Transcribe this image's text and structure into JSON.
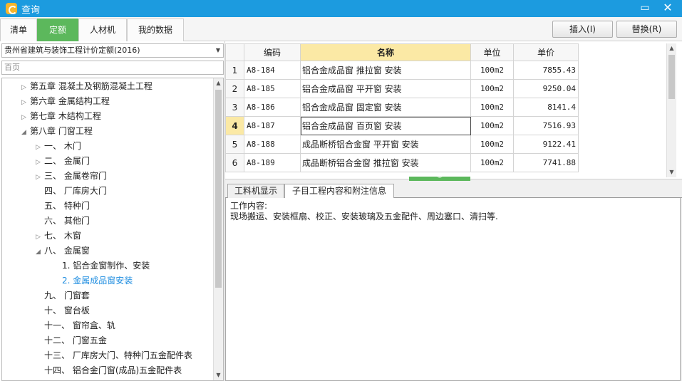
{
  "window": {
    "title": "查询",
    "minimize": "▭",
    "close": "✕"
  },
  "tabs": [
    {
      "label": "清单",
      "active": false
    },
    {
      "label": "定额",
      "active": true
    },
    {
      "label": "人材机",
      "active": false
    },
    {
      "label": "我的数据",
      "active": false
    }
  ],
  "actions": {
    "insert": "插入(I)",
    "replace": "替换(R)"
  },
  "quota_library": {
    "selected": "贵州省建筑与装饰工程计价定额(2016)"
  },
  "search": {
    "value": "百页",
    "placeholder": ""
  },
  "tree": [
    {
      "label": "第五章  混凝土及钢筋混凝土工程",
      "level": 1,
      "state": "collapsed"
    },
    {
      "label": "第六章  金属结构工程",
      "level": 1,
      "state": "collapsed"
    },
    {
      "label": "第七章  木结构工程",
      "level": 1,
      "state": "collapsed"
    },
    {
      "label": "第八章  门窗工程",
      "level": 1,
      "state": "expanded"
    },
    {
      "label": "一、  木门",
      "level": 2,
      "state": "collapsed"
    },
    {
      "label": "二、  金属门",
      "level": 2,
      "state": "collapsed"
    },
    {
      "label": "三、  金属卷帘门",
      "level": 2,
      "state": "collapsed"
    },
    {
      "label": "四、  厂库房大门",
      "level": 2,
      "state": "leaf"
    },
    {
      "label": "五、  特种门",
      "level": 2,
      "state": "leaf"
    },
    {
      "label": "六、  其他门",
      "level": 2,
      "state": "leaf"
    },
    {
      "label": "七、  木窗",
      "level": 2,
      "state": "collapsed"
    },
    {
      "label": "八、  金属窗",
      "level": 2,
      "state": "expanded"
    },
    {
      "label": "1.  铝合金窗制作、安装",
      "level": 3,
      "state": "leaf"
    },
    {
      "label": "2.  金属成品窗安装",
      "level": 3,
      "state": "leaf",
      "selected": true
    },
    {
      "label": "九、  门窗套",
      "level": 2,
      "state": "leaf"
    },
    {
      "label": "十、  窗台板",
      "level": 2,
      "state": "leaf"
    },
    {
      "label": "十一、  窗帘盒、轨",
      "level": 2,
      "state": "leaf"
    },
    {
      "label": "十二、  门窗五金",
      "level": 2,
      "state": "leaf"
    },
    {
      "label": "十三、  厂库房大门、特种门五金配件表",
      "level": 2,
      "state": "leaf"
    },
    {
      "label": "十四、  铝合金门窗(成品)五金配件表",
      "level": 2,
      "state": "leaf"
    }
  ],
  "grid": {
    "columns": [
      "编码",
      "名称",
      "单位",
      "单价"
    ],
    "rows": [
      {
        "num": "1",
        "code": "A8-184",
        "name": "铝合金成品窗  推拉窗  安装",
        "unit": "100m2",
        "price": "7855.43"
      },
      {
        "num": "2",
        "code": "A8-185",
        "name": "铝合金成品窗  平开窗  安装",
        "unit": "100m2",
        "price": "9250.04"
      },
      {
        "num": "3",
        "code": "A8-186",
        "name": "铝合金成品窗  固定窗  安装",
        "unit": "100m2",
        "price": "8141.4"
      },
      {
        "num": "4",
        "code": "A8-187",
        "name": "铝合金成品窗  百页窗  安装",
        "unit": "100m2",
        "price": "7516.93",
        "current": true
      },
      {
        "num": "5",
        "code": "A8-188",
        "name": "成品断桥铝合金窗  平开窗  安装",
        "unit": "100m2",
        "price": "9122.41"
      },
      {
        "num": "6",
        "code": "A8-189",
        "name": "成品断桥铝合金窗  推拉窗  安装",
        "unit": "100m2",
        "price": "7741.88"
      }
    ]
  },
  "detail_tabs": [
    {
      "label": "工料机显示",
      "active": false
    },
    {
      "label": "子目工程内容和附注信息",
      "active": true
    }
  ],
  "detail": {
    "heading": "工作内容:",
    "content": "现场搬运、安装框扇、校正、安装玻璃及五金配件、周边塞口、清扫等."
  },
  "colors": {
    "title_bar": "#1c9bdf",
    "accent_green": "#5cb85c",
    "selected_text": "#1e8de0",
    "header_highlight": "#fbe9a5"
  }
}
